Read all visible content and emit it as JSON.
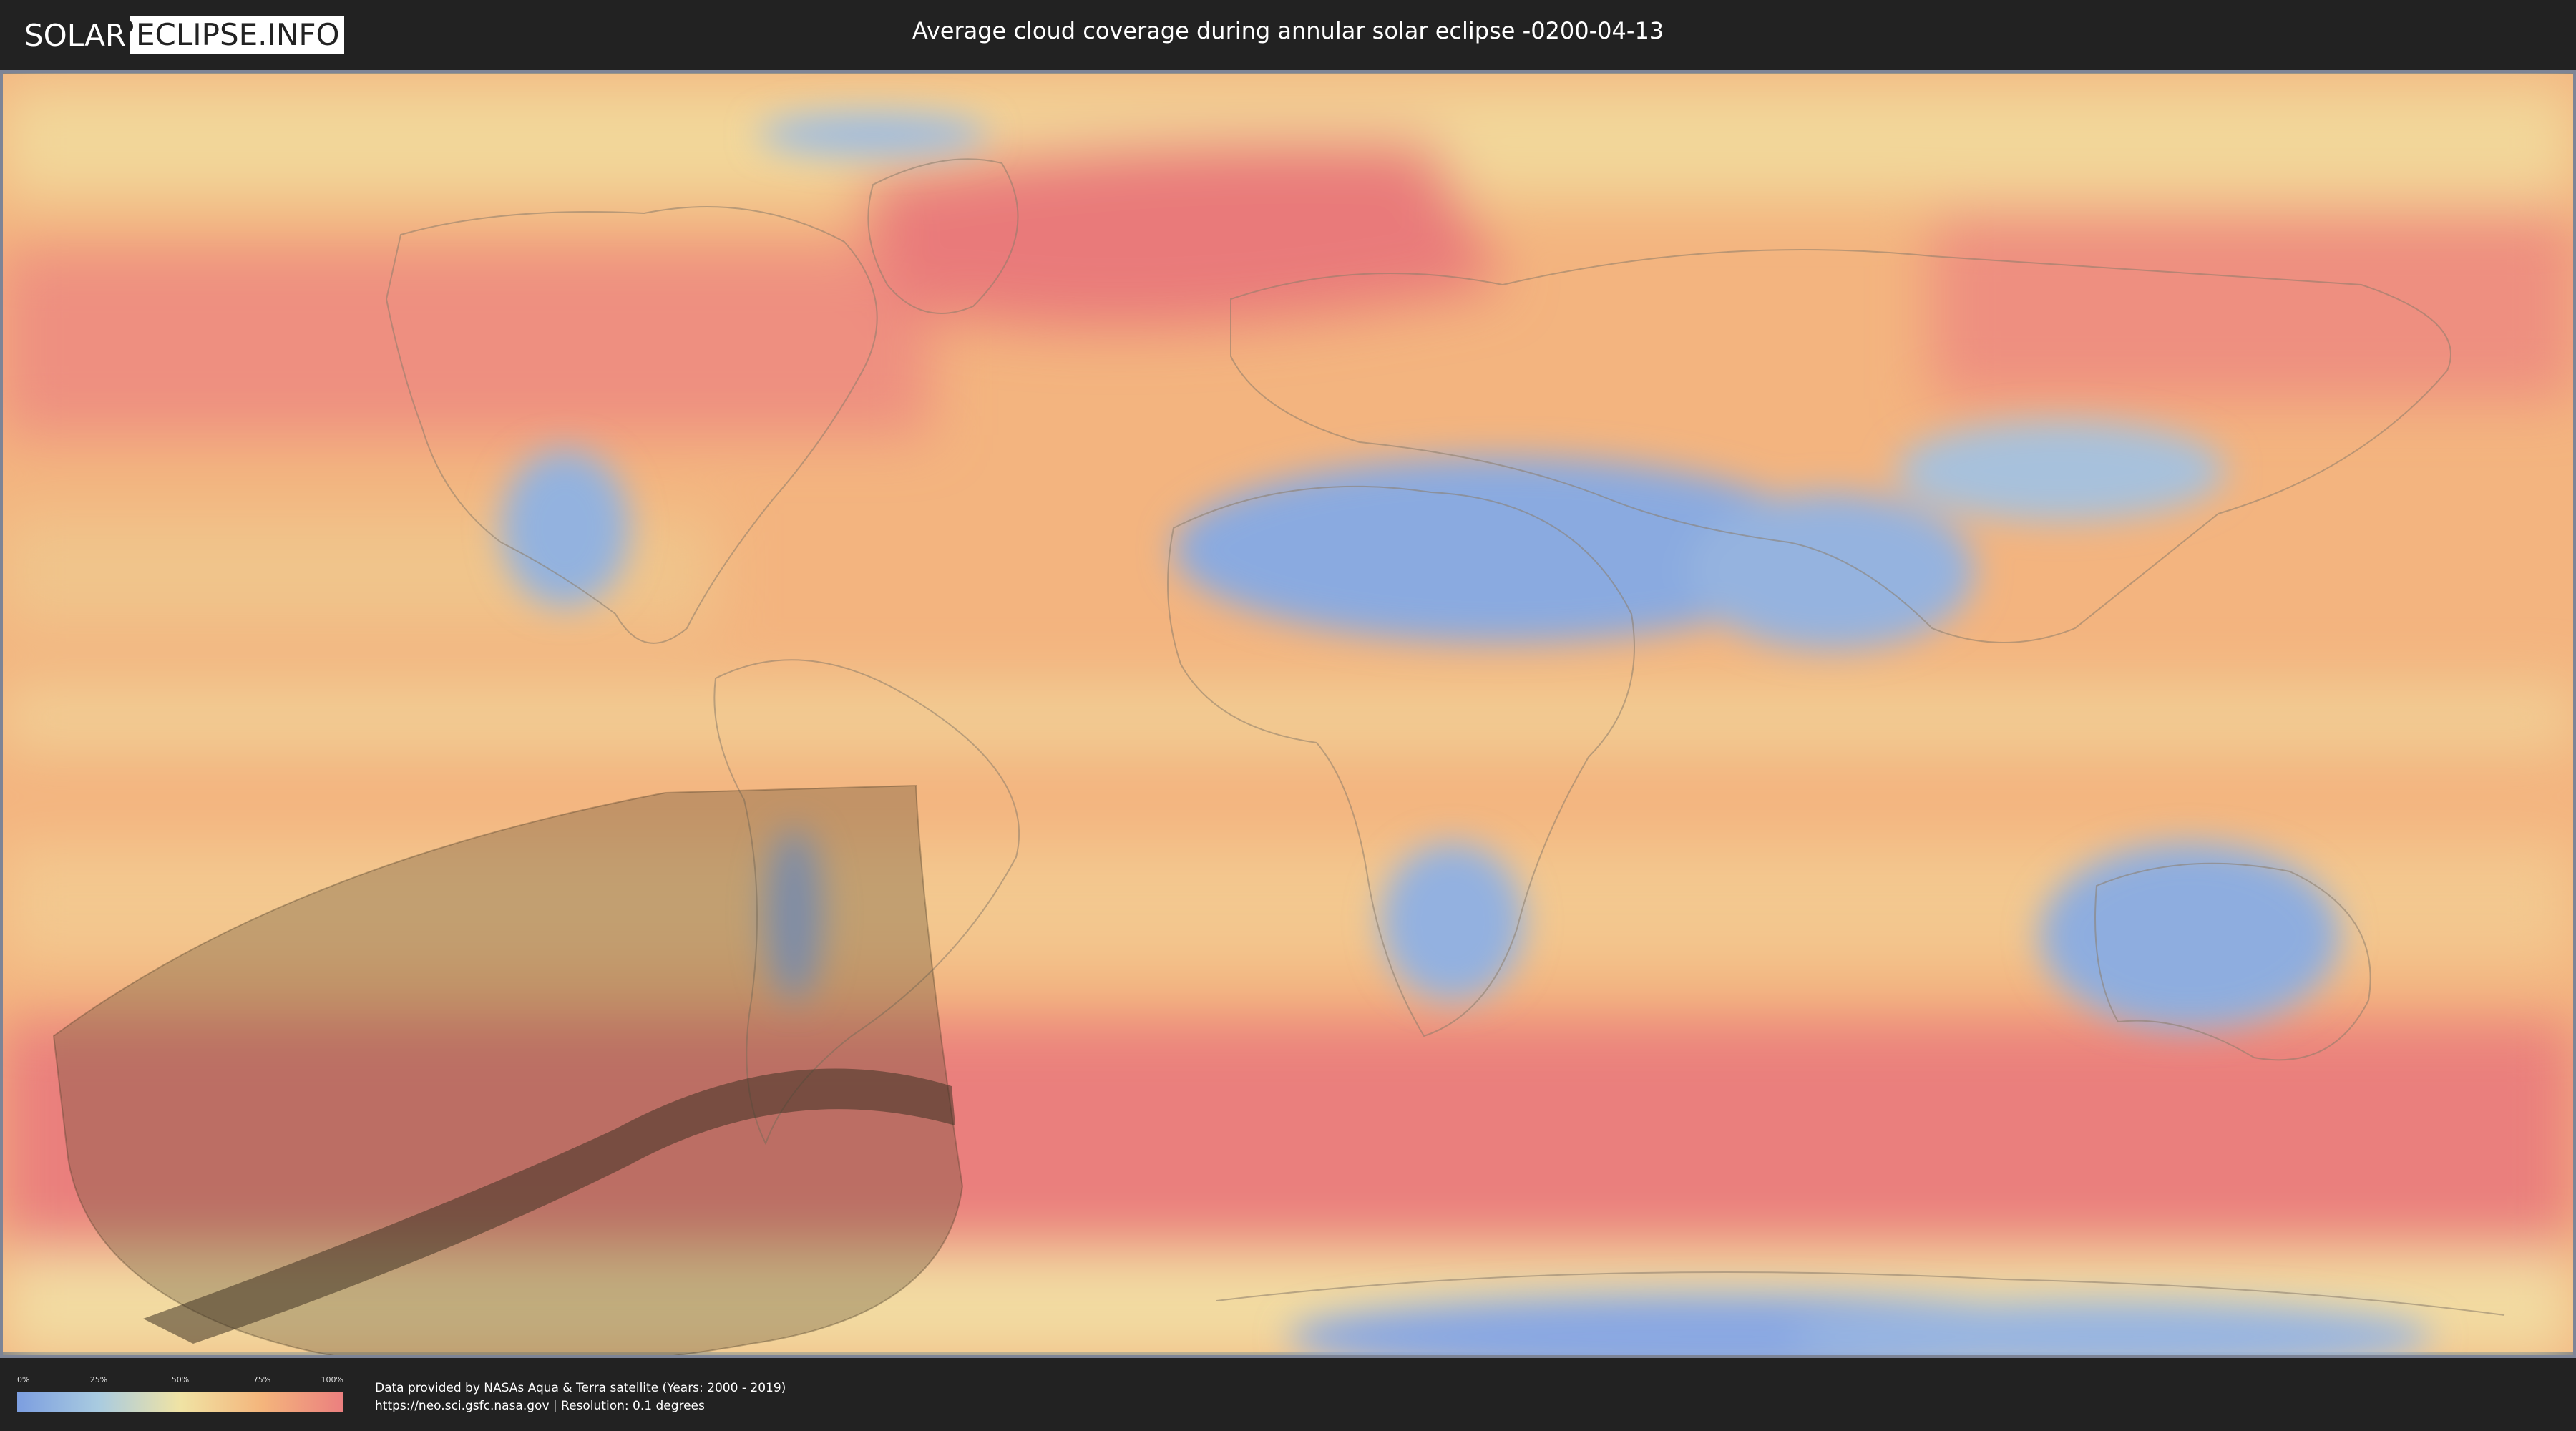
{
  "header": {
    "logo_left": "SOLAR",
    "logo_right": "ECLIPSE.INFO",
    "title": "Average cloud coverage during annular solar eclipse -0200-04-13"
  },
  "legend": {
    "ticks": [
      "0%",
      "25%",
      "50%",
      "75%",
      "100%"
    ],
    "colors": [
      "#7c9ee0",
      "#a9cbe0",
      "#f0e3a4",
      "#f4b57c",
      "#eb7f7f"
    ]
  },
  "footer": {
    "line1": "Data provided by NASAs Aqua & Terra satellite (Years: 2000 - 2019)",
    "line2": "https://neo.sci.gsfc.nasa.gov | Resolution: 0.1 degrees"
  },
  "map": {
    "base_color": "#f4b67f",
    "cloudy_color": "#ea7e7e",
    "clear_color": "#7fa2e2",
    "path_shade_color": "#5a4a32",
    "central_line_color": "#3f3324"
  }
}
